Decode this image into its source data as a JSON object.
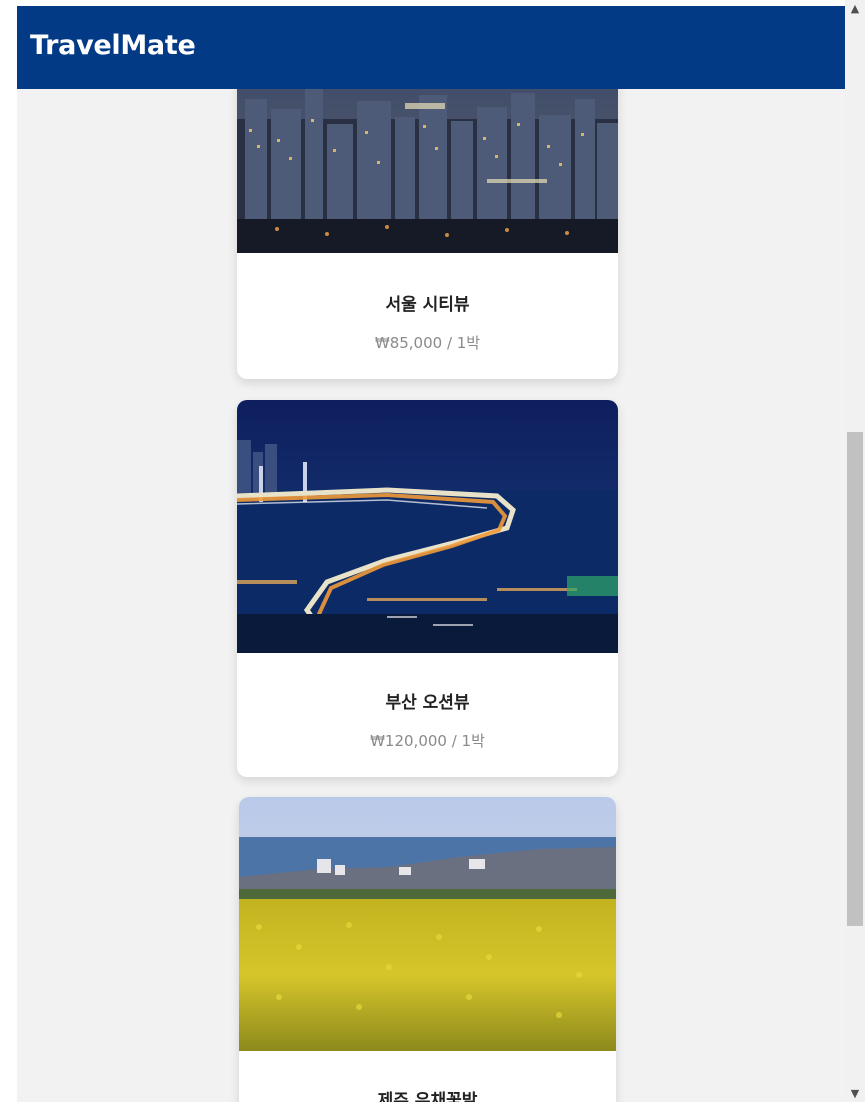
{
  "app": {
    "brand": "TravelMate"
  },
  "colors": {
    "header": "#023a85",
    "background": "#f2f2f2",
    "card": "#ffffff",
    "price": "#8a8a8a"
  },
  "listings": [
    {
      "title": "서울 시티뷰",
      "price": "₩85,000 / 1박",
      "image": "seoul-night-city-photo"
    },
    {
      "title": "부산 오션뷰",
      "price": "₩120,000 / 1박",
      "image": "busan-bridge-night-photo"
    },
    {
      "title": "제주 유채꽃밭",
      "price": "",
      "image": "jeju-canola-field-photo"
    }
  ],
  "scrollbar": {
    "up_icon": "chevron-up-icon",
    "down_icon": "chevron-down-icon"
  }
}
